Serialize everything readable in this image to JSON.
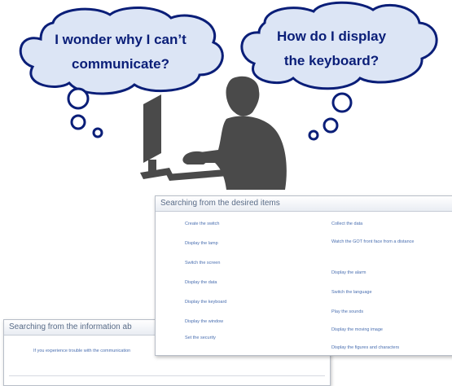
{
  "bubbles": {
    "left": {
      "line1": "I wonder why I can’t",
      "line2": "communicate?"
    },
    "right": {
      "line1": "How do I display",
      "line2": "the keyboard?"
    }
  },
  "panel_front": {
    "title": "Searching from the desired items",
    "left_items": [
      "Create the switch",
      "Display the lamp",
      "Switch the screen",
      "Display the data",
      "Display the keyboard",
      "Display the window",
      "Set the security"
    ],
    "right_items": [
      "Collect the data",
      "Watch the GOT front face from a distance",
      "Display the alarm",
      "Switch the language",
      "Play the sounds",
      "Display the moving image",
      "Display the figures and characters"
    ]
  },
  "panel_back": {
    "title": "Searching from the information ab",
    "item": "If you experience trouble with the communication"
  },
  "colors": {
    "bubble_fill": "#dce5f5",
    "bubble_stroke": "#0a1e78",
    "text": "#0a1e78",
    "person": "#4a4a4a"
  }
}
